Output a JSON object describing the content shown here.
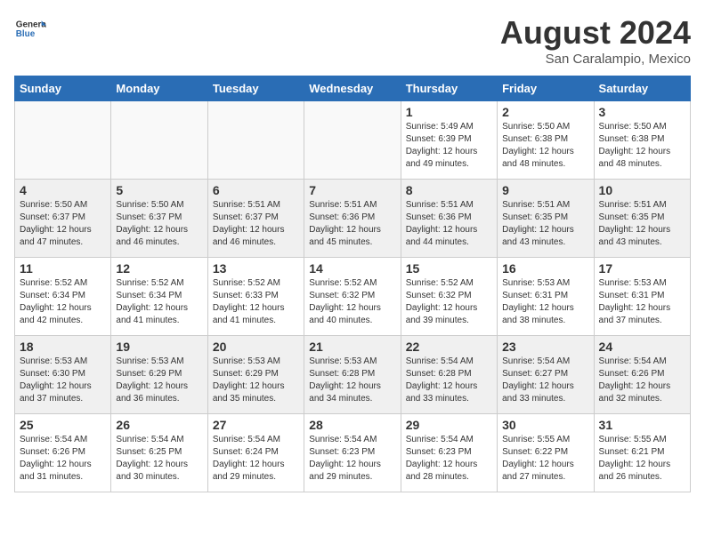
{
  "logo": {
    "text_general": "General",
    "text_blue": "Blue"
  },
  "header": {
    "month_year": "August 2024",
    "location": "San Caralampio, Mexico"
  },
  "weekdays": [
    "Sunday",
    "Monday",
    "Tuesday",
    "Wednesday",
    "Thursday",
    "Friday",
    "Saturday"
  ],
  "weeks": [
    [
      {
        "day": "",
        "info": ""
      },
      {
        "day": "",
        "info": ""
      },
      {
        "day": "",
        "info": ""
      },
      {
        "day": "",
        "info": ""
      },
      {
        "day": "1",
        "info": "Sunrise: 5:49 AM\nSunset: 6:39 PM\nDaylight: 12 hours\nand 49 minutes."
      },
      {
        "day": "2",
        "info": "Sunrise: 5:50 AM\nSunset: 6:38 PM\nDaylight: 12 hours\nand 48 minutes."
      },
      {
        "day": "3",
        "info": "Sunrise: 5:50 AM\nSunset: 6:38 PM\nDaylight: 12 hours\nand 48 minutes."
      }
    ],
    [
      {
        "day": "4",
        "info": "Sunrise: 5:50 AM\nSunset: 6:37 PM\nDaylight: 12 hours\nand 47 minutes."
      },
      {
        "day": "5",
        "info": "Sunrise: 5:50 AM\nSunset: 6:37 PM\nDaylight: 12 hours\nand 46 minutes."
      },
      {
        "day": "6",
        "info": "Sunrise: 5:51 AM\nSunset: 6:37 PM\nDaylight: 12 hours\nand 46 minutes."
      },
      {
        "day": "7",
        "info": "Sunrise: 5:51 AM\nSunset: 6:36 PM\nDaylight: 12 hours\nand 45 minutes."
      },
      {
        "day": "8",
        "info": "Sunrise: 5:51 AM\nSunset: 6:36 PM\nDaylight: 12 hours\nand 44 minutes."
      },
      {
        "day": "9",
        "info": "Sunrise: 5:51 AM\nSunset: 6:35 PM\nDaylight: 12 hours\nand 43 minutes."
      },
      {
        "day": "10",
        "info": "Sunrise: 5:51 AM\nSunset: 6:35 PM\nDaylight: 12 hours\nand 43 minutes."
      }
    ],
    [
      {
        "day": "11",
        "info": "Sunrise: 5:52 AM\nSunset: 6:34 PM\nDaylight: 12 hours\nand 42 minutes."
      },
      {
        "day": "12",
        "info": "Sunrise: 5:52 AM\nSunset: 6:34 PM\nDaylight: 12 hours\nand 41 minutes."
      },
      {
        "day": "13",
        "info": "Sunrise: 5:52 AM\nSunset: 6:33 PM\nDaylight: 12 hours\nand 41 minutes."
      },
      {
        "day": "14",
        "info": "Sunrise: 5:52 AM\nSunset: 6:32 PM\nDaylight: 12 hours\nand 40 minutes."
      },
      {
        "day": "15",
        "info": "Sunrise: 5:52 AM\nSunset: 6:32 PM\nDaylight: 12 hours\nand 39 minutes."
      },
      {
        "day": "16",
        "info": "Sunrise: 5:53 AM\nSunset: 6:31 PM\nDaylight: 12 hours\nand 38 minutes."
      },
      {
        "day": "17",
        "info": "Sunrise: 5:53 AM\nSunset: 6:31 PM\nDaylight: 12 hours\nand 37 minutes."
      }
    ],
    [
      {
        "day": "18",
        "info": "Sunrise: 5:53 AM\nSunset: 6:30 PM\nDaylight: 12 hours\nand 37 minutes."
      },
      {
        "day": "19",
        "info": "Sunrise: 5:53 AM\nSunset: 6:29 PM\nDaylight: 12 hours\nand 36 minutes."
      },
      {
        "day": "20",
        "info": "Sunrise: 5:53 AM\nSunset: 6:29 PM\nDaylight: 12 hours\nand 35 minutes."
      },
      {
        "day": "21",
        "info": "Sunrise: 5:53 AM\nSunset: 6:28 PM\nDaylight: 12 hours\nand 34 minutes."
      },
      {
        "day": "22",
        "info": "Sunrise: 5:54 AM\nSunset: 6:28 PM\nDaylight: 12 hours\nand 33 minutes."
      },
      {
        "day": "23",
        "info": "Sunrise: 5:54 AM\nSunset: 6:27 PM\nDaylight: 12 hours\nand 33 minutes."
      },
      {
        "day": "24",
        "info": "Sunrise: 5:54 AM\nSunset: 6:26 PM\nDaylight: 12 hours\nand 32 minutes."
      }
    ],
    [
      {
        "day": "25",
        "info": "Sunrise: 5:54 AM\nSunset: 6:26 PM\nDaylight: 12 hours\nand 31 minutes."
      },
      {
        "day": "26",
        "info": "Sunrise: 5:54 AM\nSunset: 6:25 PM\nDaylight: 12 hours\nand 30 minutes."
      },
      {
        "day": "27",
        "info": "Sunrise: 5:54 AM\nSunset: 6:24 PM\nDaylight: 12 hours\nand 29 minutes."
      },
      {
        "day": "28",
        "info": "Sunrise: 5:54 AM\nSunset: 6:23 PM\nDaylight: 12 hours\nand 29 minutes."
      },
      {
        "day": "29",
        "info": "Sunrise: 5:54 AM\nSunset: 6:23 PM\nDaylight: 12 hours\nand 28 minutes."
      },
      {
        "day": "30",
        "info": "Sunrise: 5:55 AM\nSunset: 6:22 PM\nDaylight: 12 hours\nand 27 minutes."
      },
      {
        "day": "31",
        "info": "Sunrise: 5:55 AM\nSunset: 6:21 PM\nDaylight: 12 hours\nand 26 minutes."
      }
    ]
  ]
}
